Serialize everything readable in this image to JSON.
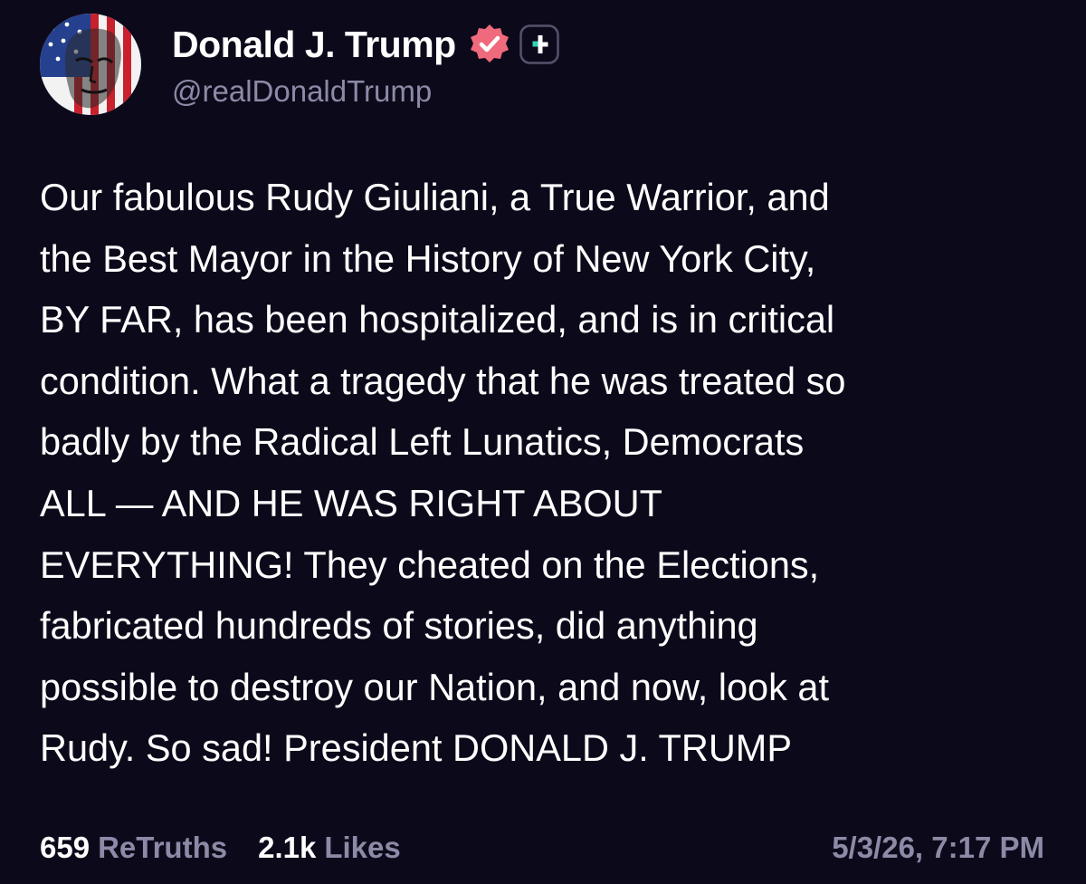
{
  "author": {
    "display_name": "Donald J. Trump",
    "handle": "@realDonaldTrump",
    "verified_icon": "verified-badge-icon",
    "verified_color": "#f06a7d",
    "plus_icon": "plus-icon",
    "plus_color": "#2fd1b7"
  },
  "post": {
    "lines": [
      "Our fabulous Rudy Giuliani, a True Warrior, and",
      "the Best Mayor in the History of New York City,",
      "BY FAR, has been hospitalized, and is in critical",
      "condition. What a tragedy that he was treated so",
      "badly by the Radical Left Lunatics, Democrats",
      "ALL — AND HE WAS RIGHT ABOUT",
      "EVERYTHING! They cheated on the Elections,",
      "fabricated hundreds of stories, did anything",
      "possible to destroy our Nation, and now, look at",
      "Rudy. So sad! President DONALD J. TRUMP"
    ]
  },
  "stats": {
    "retruths_count": "659",
    "retruths_label": "ReTruths",
    "likes_count": "2.1k",
    "likes_label": "Likes"
  },
  "timestamp": "5/3/26, 7:17 PM",
  "colors": {
    "background": "#0c0a1a",
    "text": "#ffffff",
    "muted": "#8c8aa6"
  }
}
